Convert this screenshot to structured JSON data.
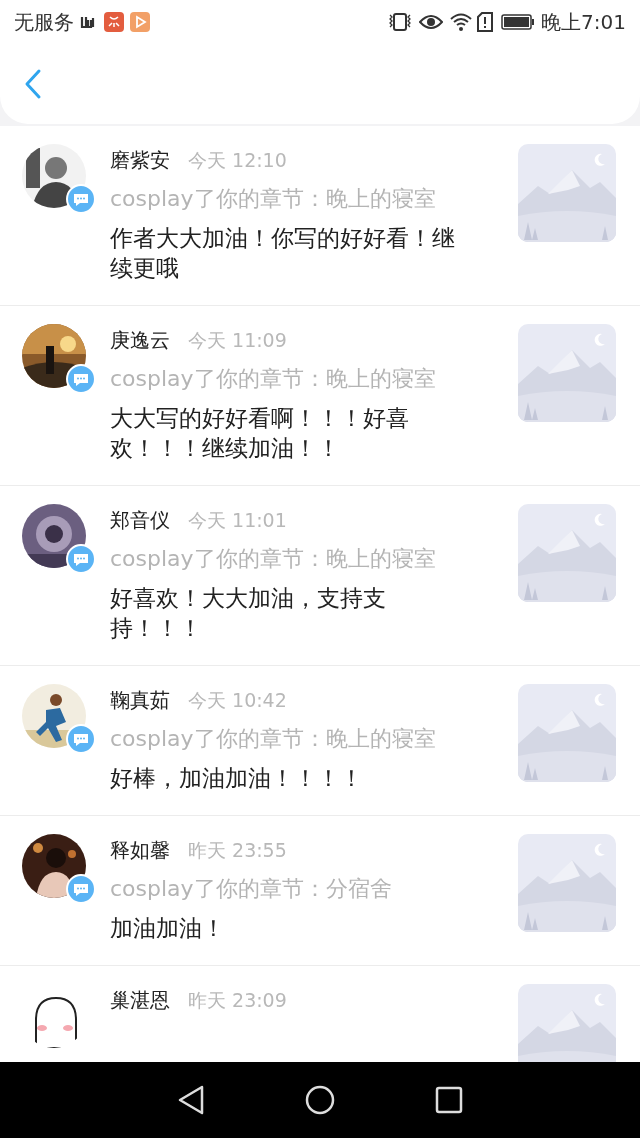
{
  "status_bar": {
    "carrier": "无服务",
    "time": "晚上7:01"
  },
  "notifications": [
    {
      "name": "磨紫安",
      "time": "今天 12:10",
      "action": "cosplay了你的章节：晚上的寝室",
      "comment": "作者大大加油！你写的好好看！继续更哦"
    },
    {
      "name": "庚逸云",
      "time": "今天 11:09",
      "action": "cosplay了你的章节：晚上的寝室",
      "comment": "大大写的好好看啊！！！好喜欢！！！继续加油！！"
    },
    {
      "name": "郑音仪",
      "time": "今天 11:01",
      "action": "cosplay了你的章节：晚上的寝室",
      "comment": "好喜欢！大大加油，支持支持！！！"
    },
    {
      "name": "鞠真茹",
      "time": "今天 10:42",
      "action": "cosplay了你的章节：晚上的寝室",
      "comment": "好棒，加油加油！！！！"
    },
    {
      "name": "释如馨",
      "time": "昨天 23:55",
      "action": "cosplay了你的章节：分宿舍",
      "comment": "加油加油！"
    },
    {
      "name": "巢湛恩",
      "time": "昨天 23:09"
    }
  ]
}
